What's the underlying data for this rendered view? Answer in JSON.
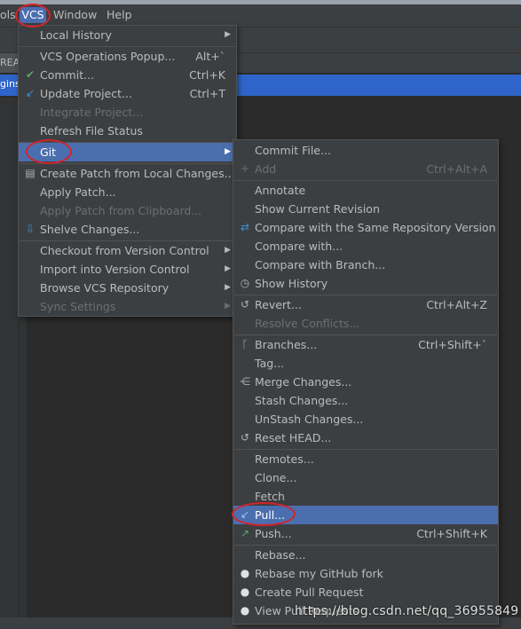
{
  "menubar": {
    "tools_fragment": "ols",
    "vcs_label": "VCS",
    "window_label": "Window",
    "help_label": "Help"
  },
  "background": {
    "tab_fragment": "REA",
    "row_fragment": "gins"
  },
  "vcs_menu": {
    "items": [
      {
        "label": "Local History",
        "shortcut": "",
        "submenu": true,
        "disabled": false
      },
      {
        "label": "VCS Operations Popup...",
        "shortcut": "Alt+`",
        "disabled": false
      },
      {
        "label": "Commit...",
        "shortcut": "Ctrl+K",
        "icon": "commit-check-icon",
        "disabled": false
      },
      {
        "label": "Update Project...",
        "shortcut": "Ctrl+T",
        "icon": "update-arrow-icon",
        "disabled": false
      },
      {
        "label": "Integrate Project...",
        "shortcut": "",
        "disabled": true
      },
      {
        "label": "Refresh File Status",
        "shortcut": "",
        "disabled": false
      },
      {
        "label": "Git",
        "shortcut": "",
        "submenu": true,
        "selected": true
      },
      {
        "label": "Create Patch from Local Changes...",
        "shortcut": "",
        "icon": "patch-icon",
        "disabled": false
      },
      {
        "label": "Apply Patch...",
        "shortcut": "",
        "disabled": false
      },
      {
        "label": "Apply Patch from Clipboard...",
        "shortcut": "",
        "disabled": true
      },
      {
        "label": "Shelve Changes...",
        "shortcut": "",
        "icon": "shelve-icon",
        "disabled": false
      },
      {
        "label": "Checkout from Version Control",
        "shortcut": "",
        "submenu": true,
        "disabled": false
      },
      {
        "label": "Import into Version Control",
        "shortcut": "",
        "submenu": true,
        "disabled": false
      },
      {
        "label": "Browse VCS Repository",
        "shortcut": "",
        "submenu": true,
        "disabled": false
      },
      {
        "label": "Sync Settings",
        "shortcut": "",
        "submenu": true,
        "disabled": true
      }
    ]
  },
  "git_menu": {
    "items": [
      {
        "label": "Commit File...",
        "shortcut": ""
      },
      {
        "label": "Add",
        "shortcut": "Ctrl+Alt+A",
        "icon": "plus-icon",
        "disabled": true
      },
      {
        "label": "Annotate",
        "shortcut": ""
      },
      {
        "label": "Show Current Revision",
        "shortcut": ""
      },
      {
        "label": "Compare with the Same Repository Version",
        "shortcut": "",
        "icon": "compare-arrows-icon"
      },
      {
        "label": "Compare with...",
        "shortcut": ""
      },
      {
        "label": "Compare with Branch...",
        "shortcut": ""
      },
      {
        "label": "Show History",
        "shortcut": "",
        "icon": "clock-icon"
      },
      {
        "label": "Revert...",
        "shortcut": "Ctrl+Alt+Z",
        "icon": "revert-icon"
      },
      {
        "label": "Resolve Conflicts...",
        "shortcut": "",
        "disabled": true
      },
      {
        "label": "Branches...",
        "shortcut": "Ctrl+Shift+`",
        "icon": "branch-icon"
      },
      {
        "label": "Tag...",
        "shortcut": ""
      },
      {
        "label": "Merge Changes...",
        "shortcut": "",
        "icon": "merge-icon"
      },
      {
        "label": "Stash Changes...",
        "shortcut": ""
      },
      {
        "label": "UnStash Changes...",
        "shortcut": ""
      },
      {
        "label": "Reset HEAD...",
        "shortcut": "",
        "icon": "reset-icon"
      },
      {
        "label": "Remotes...",
        "shortcut": ""
      },
      {
        "label": "Clone...",
        "shortcut": ""
      },
      {
        "label": "Fetch",
        "shortcut": ""
      },
      {
        "label": "Pull...",
        "shortcut": "",
        "icon": "pull-arrow-icon",
        "selected": true
      },
      {
        "label": "Push...",
        "shortcut": "Ctrl+Shift+K",
        "icon": "push-arrow-icon"
      },
      {
        "label": "Rebase...",
        "shortcut": ""
      },
      {
        "label": "Rebase my GitHub fork",
        "shortcut": "",
        "icon": "github-icon"
      },
      {
        "label": "Create Pull Request",
        "shortcut": "",
        "icon": "github-icon"
      },
      {
        "label": "View Pull Requests",
        "shortcut": "",
        "icon": "github-icon"
      }
    ]
  },
  "watermark": "https://blog.csdn.net/qq_36955849",
  "colors": {
    "menu_bg": "#3c3f41",
    "selection": "#4b6eaf",
    "annotation_red": "#d3232a"
  }
}
